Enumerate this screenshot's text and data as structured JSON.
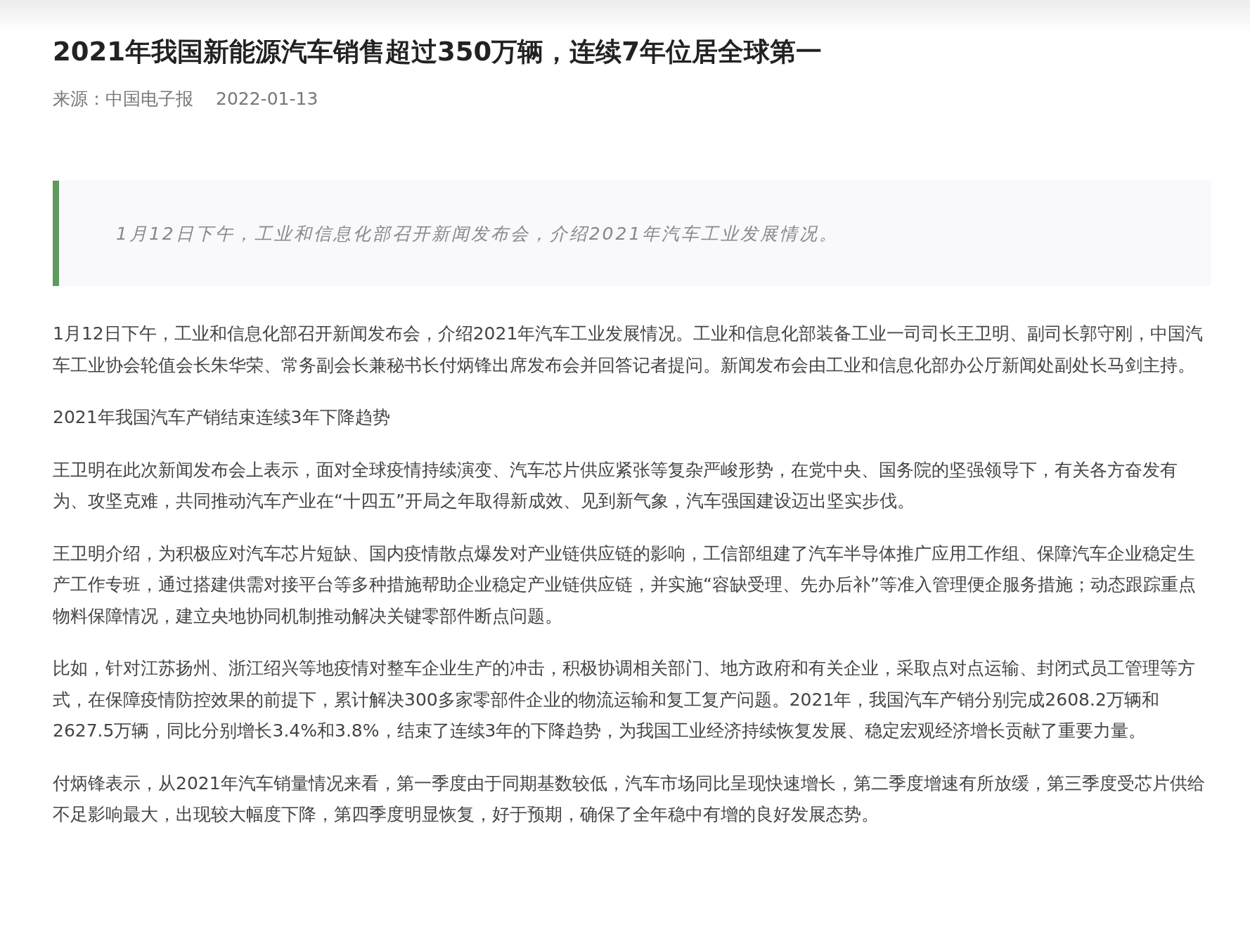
{
  "article": {
    "title": "2021年我国新能源汽车销售超过350万辆，连续7年位居全球第一",
    "source": "来源：中国电子报",
    "date": "2022-01-13",
    "lead_quote": "1月12日下午，工业和信息化部召开新闻发布会，介绍2021年汽车工业发展情况。",
    "paragraphs": [
      "1月12日下午，工业和信息化部召开新闻发布会，介绍2021年汽车工业发展情况。工业和信息化部装备工业一司司长王卫明、副司长郭守刚，中国汽车工业协会轮值会长朱华荣、常务副会长兼秘书长付炳锋出席发布会并回答记者提问。新闻发布会由工业和信息化部办公厅新闻处副处长马剑主持。",
      "2021年我国汽车产销结束连续3年下降趋势",
      "王卫明在此次新闻发布会上表示，面对全球疫情持续演变、汽车芯片供应紧张等复杂严峻形势，在党中央、国务院的坚强领导下，有关各方奋发有为、攻坚克难，共同推动汽车产业在“十四五”开局之年取得新成效、见到新气象，汽车强国建设迈出坚实步伐。",
      "王卫明介绍，为积极应对汽车芯片短缺、国内疫情散点爆发对产业链供应链的影响，工信部组建了汽车半导体推广应用工作组、保障汽车企业稳定生产工作专班，通过搭建供需对接平台等多种措施帮助企业稳定产业链供应链，并实施“容缺受理、先办后补”等准入管理便企服务措施；动态跟踪重点物料保障情况，建立央地协同机制推动解决关键零部件断点问题。",
      "比如，针对江苏扬州、浙江绍兴等地疫情对整车企业生产的冲击，积极协调相关部门、地方政府和有关企业，采取点对点运输、封闭式员工管理等方式，在保障疫情防控效果的前提下，累计解决300多家零部件企业的物流运输和复工复产问题。2021年，我国汽车产销分别完成2608.2万辆和2627.5万辆，同比分别增长3.4%和3.8%，结束了连续3年的下降趋势，为我国工业经济持续恢复发展、稳定宏观经济增长贡献了重要力量。",
      "付炳锋表示，从2021年汽车销量情况来看，第一季度由于同期基数较低，汽车市场同比呈现快速增长，第二季度增速有所放缓，第三季度受芯片供给不足影响最大，出现较大幅度下降，第四季度明显恢复，好于预期，确保了全年稳中有增的良好发展态势。"
    ]
  }
}
